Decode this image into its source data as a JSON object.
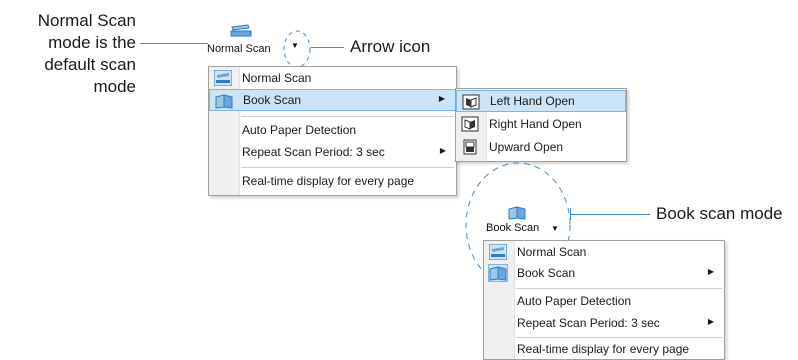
{
  "annotations": {
    "normal_scan_note": [
      "Normal Scan",
      "mode is the",
      "default scan",
      "mode"
    ],
    "arrow_icon_note": "Arrow icon",
    "book_scan_note": "Book scan mode"
  },
  "toolbar1": {
    "button_label": "Normal Scan",
    "button_icon": "scanner-icon",
    "arrow_icon": "chevron-down-icon",
    "arrow_glyph": "▼"
  },
  "menu1": {
    "items": [
      {
        "label": "Normal Scan",
        "icon": "scanner-icon"
      },
      {
        "label": "Book Scan",
        "icon": "book-icon",
        "submenu_glyph": "▶"
      },
      {
        "label": "Auto Paper Detection"
      },
      {
        "label": "Repeat Scan Period:  3 sec",
        "submenu_glyph": "▶"
      },
      {
        "label": "Real-time display for every page"
      }
    ],
    "selected": "Book Scan"
  },
  "submenu": {
    "items": [
      {
        "label": "Left Hand Open",
        "icon": "left-hand-open-icon"
      },
      {
        "label": "Right Hand Open",
        "icon": "right-hand-open-icon"
      },
      {
        "label": "Upward Open",
        "icon": "upward-open-icon"
      }
    ],
    "highlighted": "Left Hand Open"
  },
  "toolbar2": {
    "button_label": "Book Scan",
    "button_icon": "book-icon",
    "arrow_icon": "chevron-down-icon",
    "arrow_glyph": "▼"
  },
  "menu2": {
    "items": [
      {
        "label": "Normal Scan",
        "icon": "scanner-icon"
      },
      {
        "label": "Book Scan",
        "icon": "book-icon",
        "submenu_glyph": "▶"
      },
      {
        "label": "Auto Paper Detection"
      },
      {
        "label": "Repeat Scan Period:  3 sec",
        "submenu_glyph": "▶"
      },
      {
        "label": "Real-time display for every page"
      }
    ],
    "selected": "Book Scan"
  },
  "colors": {
    "callout_line": "#3b8fd0",
    "highlight_bg": "#cce4f7",
    "icon_blue": "#2e7cc4"
  }
}
